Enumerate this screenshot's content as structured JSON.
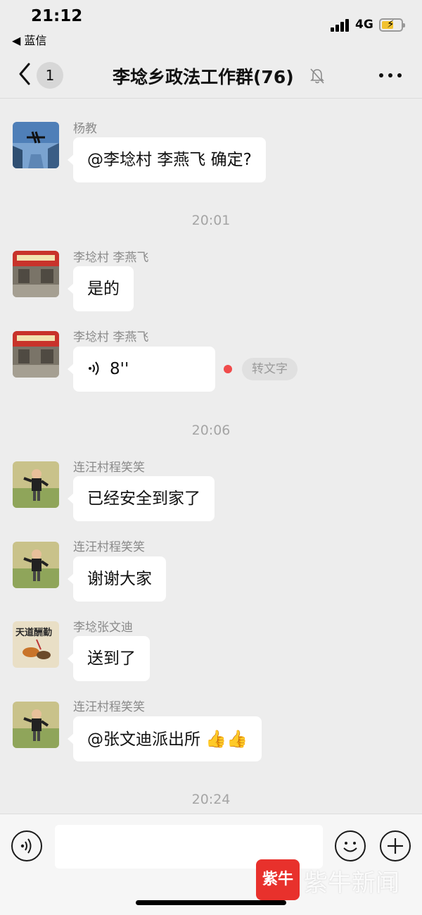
{
  "status_bar": {
    "time": "21:12",
    "back_app": "◀ 蓝信",
    "network": "4G",
    "battery_icon": "battery-charging-icon",
    "signal_icon": "cellular-signal-icon"
  },
  "header": {
    "unread_count": "1",
    "title": "李埝乡政法工作群(76)",
    "icons": [
      "chevron-left-icon",
      "mute-bell-icon",
      "more-dots-icon"
    ]
  },
  "messages": [
    {
      "sender": "杨教",
      "text": "@李埝村  李燕飞 确定?",
      "avatar": "airplane-skyscraper-avatar"
    },
    {
      "timestamp": "20:01"
    },
    {
      "sender": "李埝村  李燕飞",
      "text": "是的",
      "avatar": "storefront-avatar"
    },
    {
      "sender": "李埝村  李燕飞",
      "voice_duration": "8''",
      "to_text_label": "转文字",
      "avatar": "storefront-avatar"
    },
    {
      "timestamp": "20:06"
    },
    {
      "sender": "连汪村程笑笑",
      "text": "已经安全到家了",
      "avatar": "child-photo-avatar"
    },
    {
      "sender": "连汪村程笑笑",
      "text": "谢谢大家",
      "avatar": "child-photo-avatar"
    },
    {
      "sender": "李埝张文迪",
      "text": "送到了",
      "avatar": "calligraphy-painting-avatar"
    },
    {
      "sender": "连汪村程笑笑",
      "text": "@张文迪派出所",
      "emoji": "👍👍",
      "avatar": "child-photo-avatar"
    },
    {
      "timestamp": "20:24"
    }
  ],
  "input_bar": {
    "placeholder": "",
    "icons": [
      "voice-input-icon",
      "emoji-icon",
      "plus-icon"
    ]
  },
  "watermark": {
    "logo_text": "紫牛",
    "text": "紫牛新闻"
  },
  "colors": {
    "background": "#ededed",
    "bubble": "#ffffff",
    "unread_dot": "#f04b4b",
    "watermark_red": "#e8312c"
  }
}
